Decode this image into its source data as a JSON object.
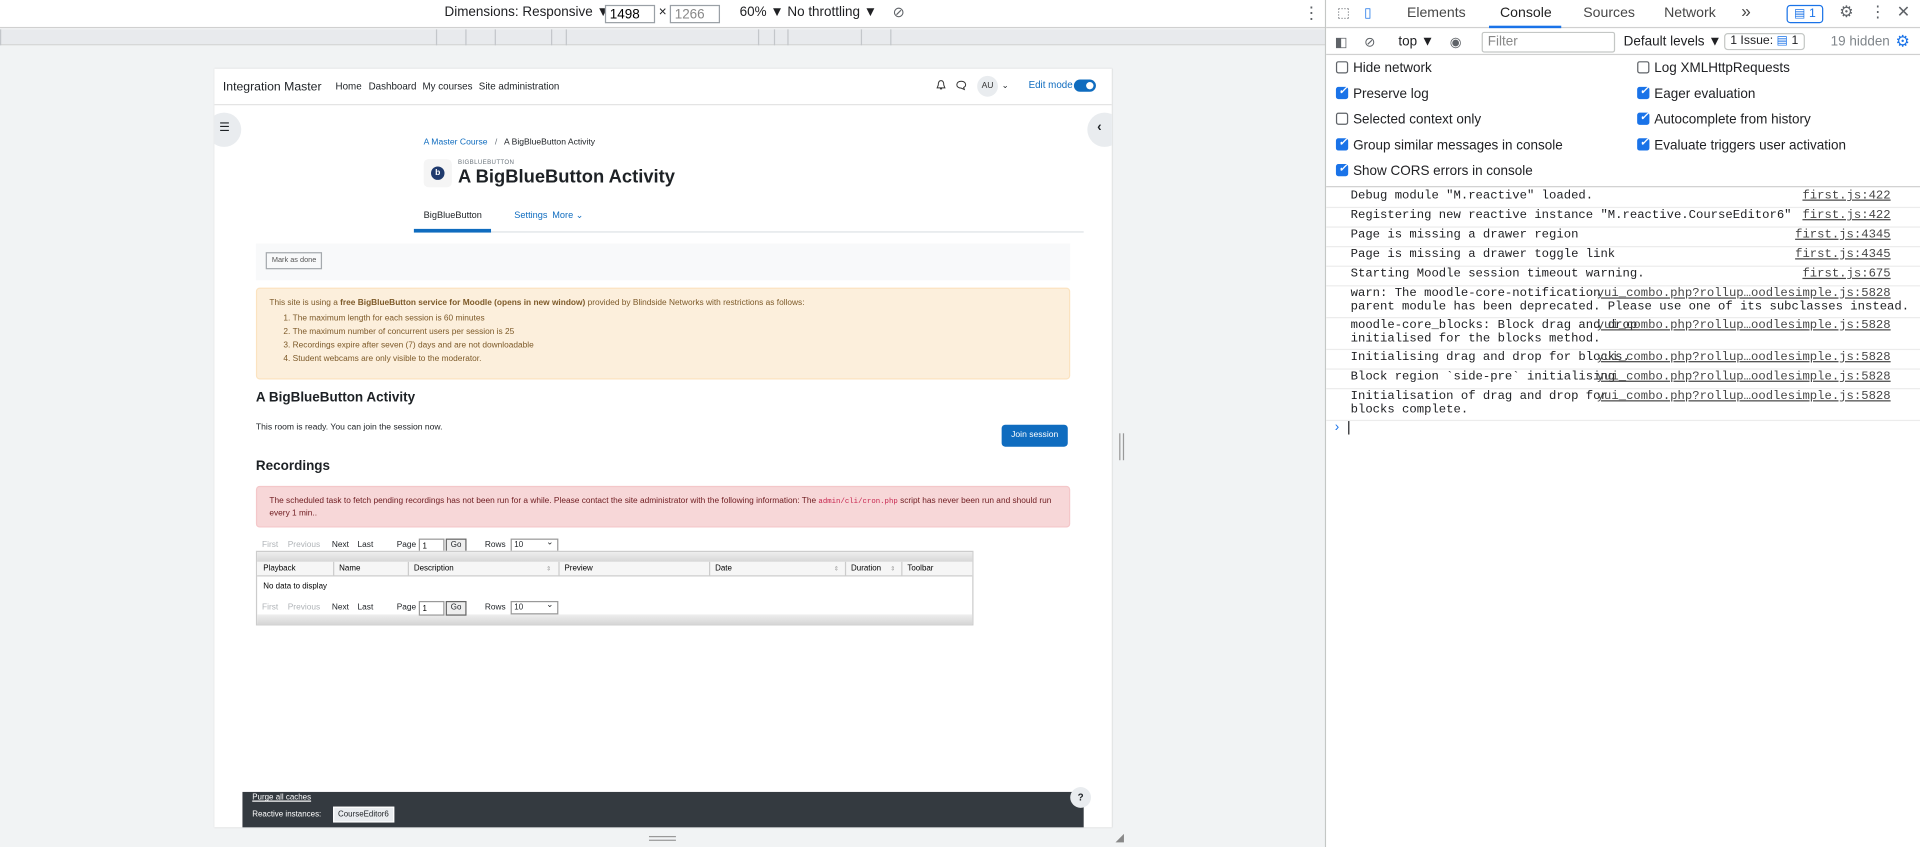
{
  "device_toolbar": {
    "dimensions_label": "Dimensions: Responsive",
    "width": "1498",
    "times": "×",
    "height": "1266",
    "zoom": "60%",
    "throttling": "No throttling"
  },
  "moodle": {
    "site_name": "Integration Master",
    "nav": [
      "Home",
      "Dashboard",
      "My courses",
      "Site administration"
    ],
    "avatar_initials": "AU",
    "edit_mode_label": "Edit mode",
    "breadcrumb": {
      "course": "A Master Course",
      "separator": "/",
      "current": "A BigBlueButton Activity"
    },
    "module_type": "BIGBLUEBUTTON",
    "module_icon_letter": "b",
    "page_title": "A BigBlueButton Activity",
    "tabs": [
      "BigBlueButton",
      "Settings",
      "More ⌄"
    ],
    "mark_done_label": "Mark as done",
    "warning": {
      "intro_prefix": "This site is using a ",
      "intro_bold": "free BigBlueButton service for Moodle (opens in new window)",
      "intro_suffix": " provided by Blindside Networks with restrictions as follows:",
      "items": [
        "The maximum length for each session is 60 minutes",
        "The maximum number of concurrent users per session is 25",
        "Recordings expire after seven (7) days and are not downloadable",
        "Student webcams are only visible to the moderator."
      ]
    },
    "room_heading": "A BigBlueButton Activity",
    "room_status": "This room is ready. You can join the session now.",
    "join_label": "Join session",
    "recordings_heading": "Recordings",
    "recordings_alert": {
      "before": "The scheduled task to fetch pending recordings has not been run for a while. Please contact the site administrator with the following information: The ",
      "code": "admin/cli/cron.php",
      "after": " script has never been run and should run every 1 min.."
    },
    "pager": {
      "first": "First",
      "previous": "Previous",
      "next": "Next",
      "last": "Last",
      "page_label": "Page",
      "page_value": "1",
      "go": "Go",
      "rows_label": "Rows",
      "rows_value": "10"
    },
    "table_columns": [
      "Playback",
      "Name",
      "Description",
      "Preview",
      "Date",
      "Duration",
      "Toolbar"
    ],
    "sort_icon": "⇕",
    "no_data": "No data to display",
    "footer": {
      "purge": "Purge all caches",
      "reactive_label": "Reactive instances:",
      "reactive_value": "CourseEditor6"
    },
    "help_label": "?"
  },
  "devtools": {
    "tabs": [
      "Elements",
      "Console",
      "Sources",
      "Network"
    ],
    "more_tabs": "»",
    "badge_count": "1",
    "context": "top",
    "filter_placeholder": "Filter",
    "levels": "Default levels",
    "issue_label": "1 Issue:",
    "issue_count": "1",
    "hidden_count": "19 hidden",
    "options": [
      {
        "label": "Hide network",
        "checked": false
      },
      {
        "label": "Log XMLHttpRequests",
        "checked": false
      },
      {
        "label": "Preserve log",
        "checked": true
      },
      {
        "label": "Eager evaluation",
        "checked": true
      },
      {
        "label": "Selected context only",
        "checked": false
      },
      {
        "label": "Autocomplete from history",
        "checked": true
      },
      {
        "label": "Group similar messages in console",
        "checked": true
      },
      {
        "label": "Evaluate triggers user activation",
        "checked": true
      },
      {
        "label": "Show CORS errors in console",
        "checked": true
      }
    ],
    "logs": [
      {
        "msg": "Debug module \"M.reactive\" loaded.",
        "src": "first.js:422"
      },
      {
        "msg": "Registering new reactive instance \"M.reactive.CourseEditor6\"",
        "src": "first.js:422"
      },
      {
        "msg": "Page is missing a drawer region",
        "src": "first.js:4345"
      },
      {
        "msg": "Page is missing a drawer toggle link",
        "src": "first.js:4345"
      },
      {
        "msg": "Starting Moodle session timeout warning.",
        "src": "first.js:675"
      },
      {
        "msg": "warn: The moodle-core-notification\nparent module has been deprecated. Please use one of its subclasses instead.",
        "src": "yui_combo.php?rollup…oodlesimple.js:5828"
      },
      {
        "msg": "moodle-core_blocks: Block drag and drop\ninitialised for the blocks method.",
        "src": "yui_combo.php?rollup…oodlesimple.js:5828"
      },
      {
        "msg": "Initialising drag and drop for blocks.",
        "src": "yui_combo.php?rollup…oodlesimple.js:5828"
      },
      {
        "msg": "Block region `side-pre` initialising",
        "src": "yui_combo.php?rollup…oodlesimple.js:5828"
      },
      {
        "msg": "Initialisation of drag and drop for\nblocks complete.",
        "src": "yui_combo.php?rollup…oodlesimple.js:5828"
      }
    ],
    "prompt": "›"
  }
}
